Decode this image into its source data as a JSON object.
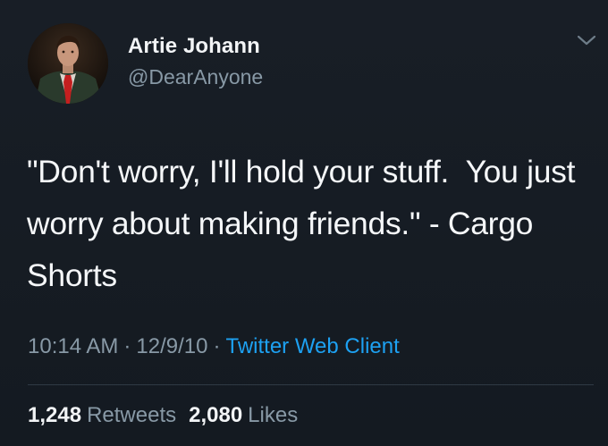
{
  "tweet": {
    "author": {
      "display_name": "Artie Johann",
      "handle": "@DearAnyone"
    },
    "text": "\"Don't worry, I'll hold your stuff.  You just worry about making friends.\" - Cargo Shorts",
    "meta": {
      "time": "10:14 AM",
      "separator": "·",
      "date": "12/9/10",
      "client": "Twitter Web Client"
    },
    "stats": {
      "retweets_count": "1,248",
      "retweets_label": "Retweets",
      "likes_count": "2,080",
      "likes_label": "Likes"
    },
    "icons": {
      "menu": "chevron-down-icon",
      "avatar": "avatar"
    },
    "colors": {
      "background": "#161c23",
      "text": "#f5f7f9",
      "secondary": "#8899a6",
      "link": "#1da1f2"
    }
  }
}
